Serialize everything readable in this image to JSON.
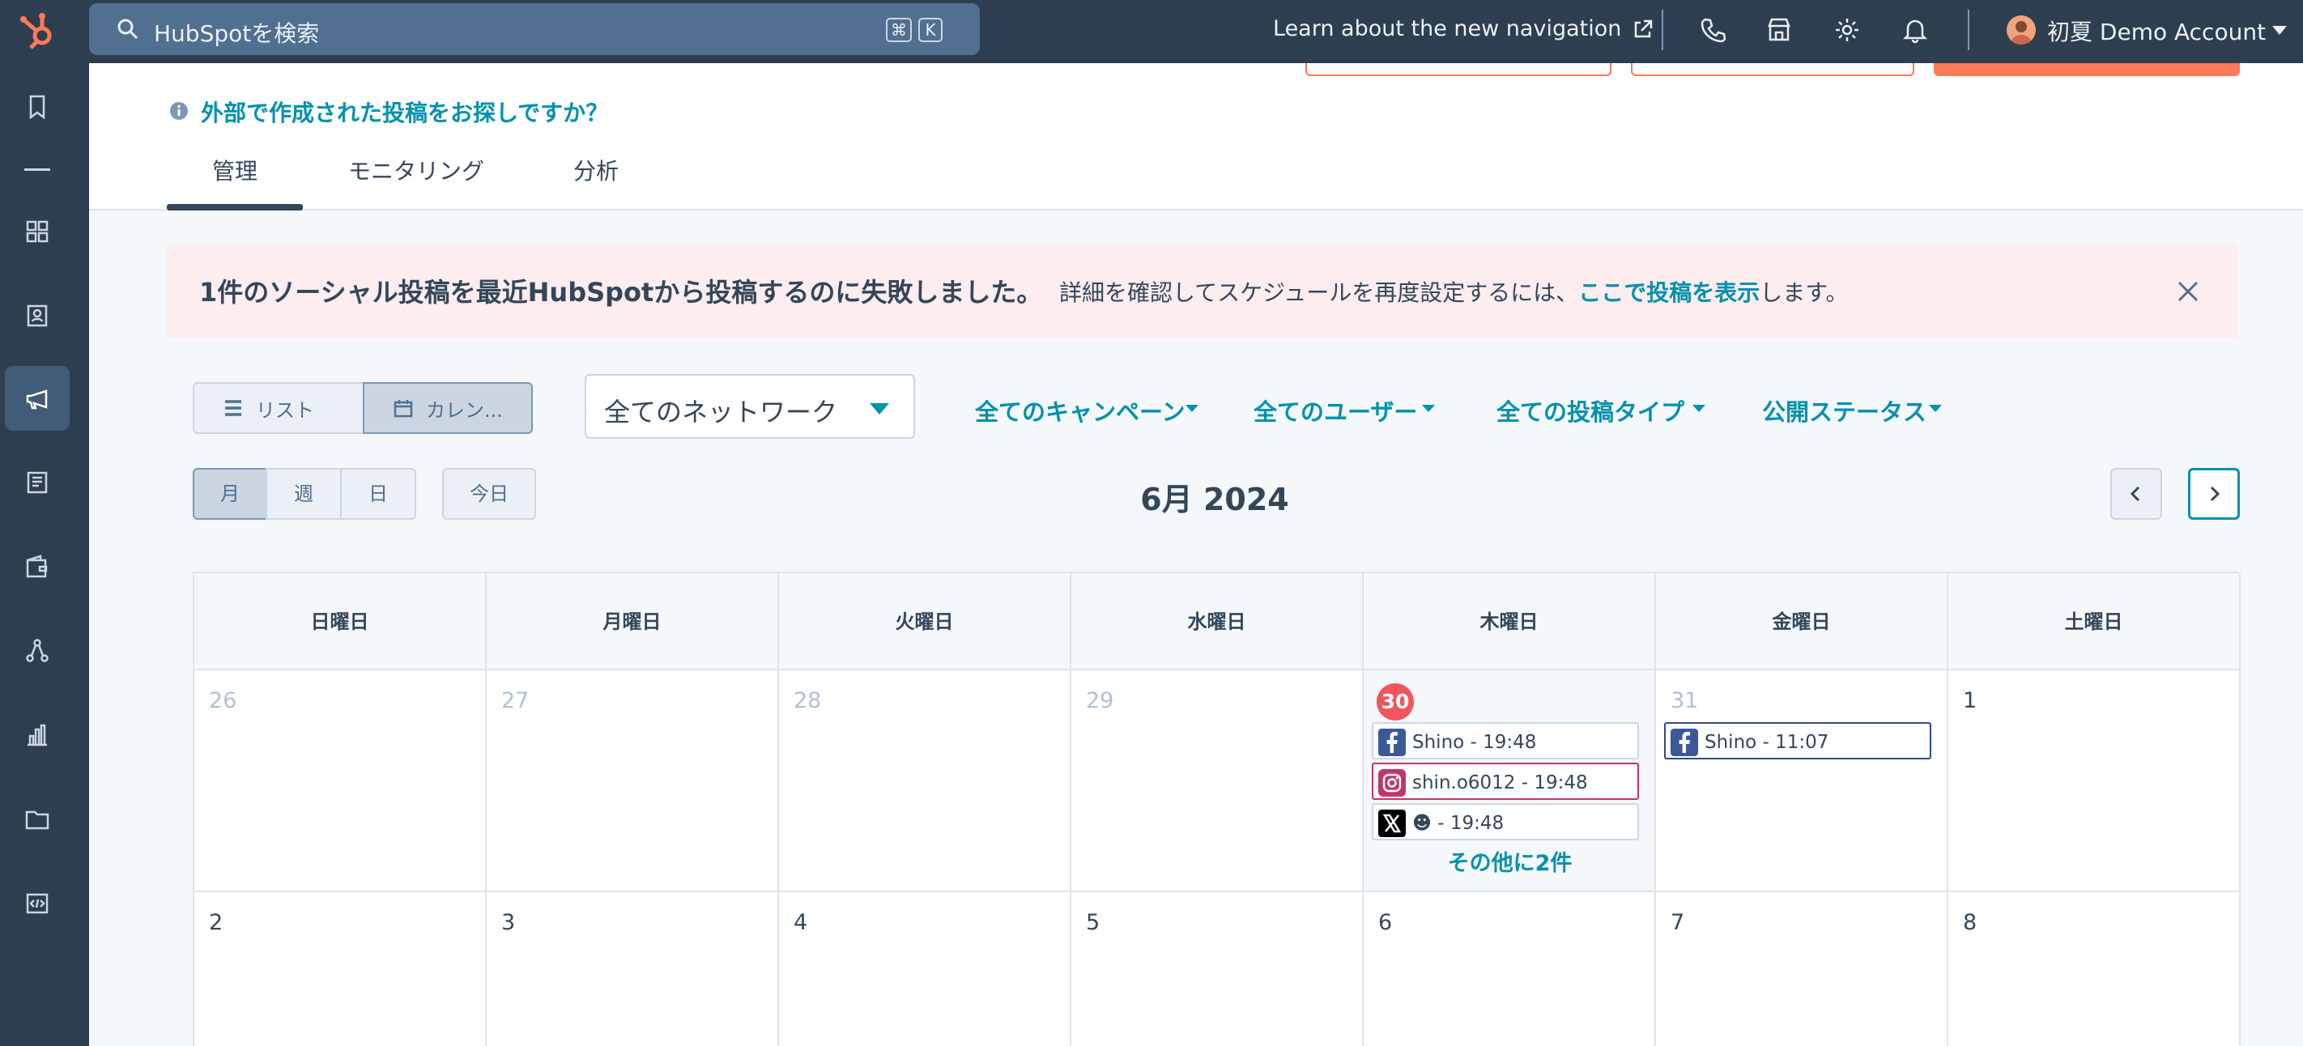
{
  "topbar": {
    "search_placeholder": "HubSpotを検索",
    "shortcut_cmd": "⌘",
    "shortcut_k": "K",
    "learn_link": "Learn about the new navigation",
    "account_name": "初夏 Demo Account"
  },
  "header": {
    "external_posts_link": "外部で作成された投稿をお探しですか？",
    "tabs": [
      {
        "label": "管理",
        "active": true
      },
      {
        "label": "モニタリング",
        "active": false
      },
      {
        "label": "分析",
        "active": false
      }
    ]
  },
  "alert": {
    "title": "1件のソーシャル投稿を最近HubSpotから投稿するのに失敗しました。",
    "desc_before": "詳細を確認してスケジュールを再度設定するには、",
    "desc_link": "ここで投稿を表示",
    "desc_after": "します。"
  },
  "view_toggle": {
    "list_label": "リスト",
    "calendar_label": "カレン..."
  },
  "network_filter": {
    "selected": "全てのネットワーク"
  },
  "filters": [
    "全てのキャンペーン",
    "全てのユーザー",
    "全ての投稿タイプ",
    "公開ステータス"
  ],
  "period": {
    "month": "月",
    "week": "週",
    "day": "日",
    "today": "今日"
  },
  "calendar": {
    "title": "6月 2024",
    "weekdays": [
      "日曜日",
      "月曜日",
      "火曜日",
      "水曜日",
      "木曜日",
      "金曜日",
      "土曜日"
    ],
    "week1": [
      {
        "day": "26",
        "muted": true
      },
      {
        "day": "27",
        "muted": true
      },
      {
        "day": "28",
        "muted": true
      },
      {
        "day": "29",
        "muted": true
      },
      {
        "day": "30",
        "today": true,
        "events": [
          {
            "network": "facebook",
            "label": "Shino - 19:48"
          },
          {
            "network": "instagram",
            "label": "shin.o6012 - 19:48"
          },
          {
            "network": "x",
            "label": "☻ - 19:48"
          }
        ],
        "more": "その他に2件"
      },
      {
        "day": "31",
        "muted": true,
        "events": [
          {
            "network": "facebook",
            "label": "Shino - 11:07"
          }
        ]
      },
      {
        "day": "1"
      }
    ],
    "week2": [
      {
        "day": "2"
      },
      {
        "day": "3"
      },
      {
        "day": "4"
      },
      {
        "day": "5"
      },
      {
        "day": "6"
      },
      {
        "day": "7"
      },
      {
        "day": "8"
      }
    ]
  },
  "colors": {
    "brand_orange": "#ff7a59",
    "link": "#0091ae",
    "nav_bg": "#2d3e50",
    "today_red": "#f2545b"
  }
}
